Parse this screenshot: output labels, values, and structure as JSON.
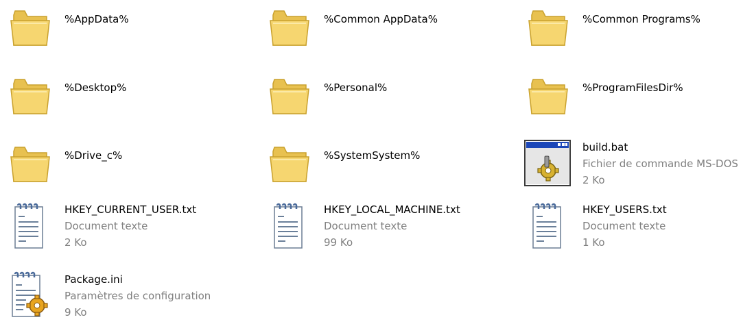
{
  "items": [
    {
      "name": "%AppData%",
      "icon": "folder-icon"
    },
    {
      "name": "%Common AppData%",
      "icon": "folder-icon"
    },
    {
      "name": "%Common Programs%",
      "icon": "folder-icon"
    },
    {
      "name": "%Desktop%",
      "icon": "folder-icon"
    },
    {
      "name": "%Personal%",
      "icon": "folder-icon"
    },
    {
      "name": "%ProgramFilesDir%",
      "icon": "folder-icon"
    },
    {
      "name": "%Drive_c%",
      "icon": "folder-icon"
    },
    {
      "name": "%SystemSystem%",
      "icon": "folder-icon"
    },
    {
      "name": "build.bat",
      "type": "Fichier de commande MS-DOS",
      "size": "2 Ko",
      "icon": "batch-file-icon"
    },
    {
      "name": "HKEY_CURRENT_USER.txt",
      "type": "Document texte",
      "size": "2 Ko",
      "icon": "text-document-icon"
    },
    {
      "name": "HKEY_LOCAL_MACHINE.txt",
      "type": "Document texte",
      "size": "99 Ko",
      "icon": "text-document-icon"
    },
    {
      "name": "HKEY_USERS.txt",
      "type": "Document texte",
      "size": "1 Ko",
      "icon": "text-document-icon"
    },
    {
      "name": "Package.ini",
      "type": "Paramètres de configuration",
      "size": "9 Ko",
      "icon": "config-file-icon"
    }
  ],
  "colors": {
    "folder_fill": "#f6d670",
    "folder_edge": "#c9a12d",
    "secondary_text": "#7f7f7f",
    "batch_titlebar": "#1c47b8"
  }
}
